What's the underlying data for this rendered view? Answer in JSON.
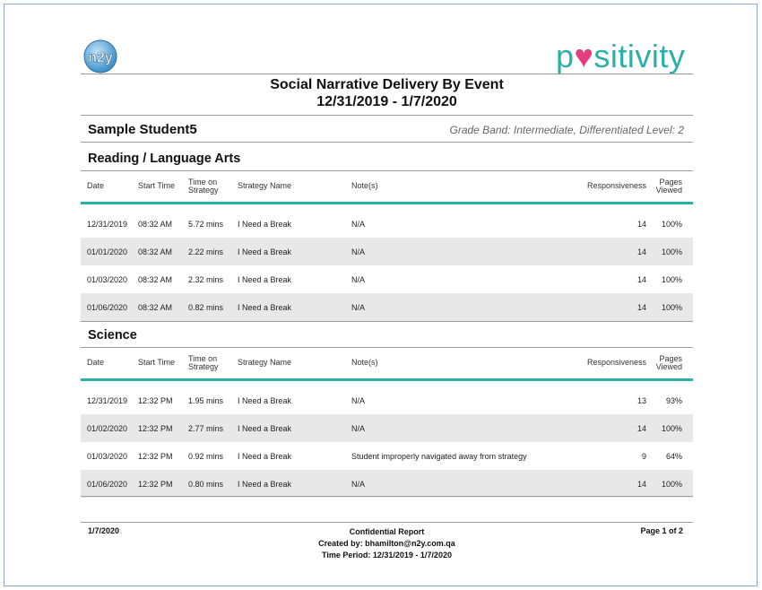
{
  "header": {
    "title": "Social Narrative Delivery By Event",
    "date_range": "12/31/2019 - 1/7/2020",
    "logo_left_text": "n2y",
    "logo_right": {
      "pre": "p",
      "heart": "♥",
      "post": "sitivity"
    }
  },
  "student": {
    "name": "Sample Student5",
    "grade_band": "Grade Band: Intermediate, Differentiated Level: 2"
  },
  "columns": {
    "date": "Date",
    "start_time": "Start Time",
    "time_on_1": "Time on",
    "time_on_2": "Strategy",
    "strategy": "Strategy Name",
    "notes": "Note(s)",
    "responsiveness": "Responsiveness",
    "pages_1": "Pages",
    "pages_2": "Viewed"
  },
  "sections": [
    {
      "title": "Reading / Language Arts",
      "rows": [
        {
          "date": "12/31/2019",
          "start": "08:32 AM",
          "time": "5.72 mins",
          "strategy": "I Need a Break",
          "notes": "N/A",
          "resp": "14",
          "pages": "100%"
        },
        {
          "date": "01/01/2020",
          "start": "08:32 AM",
          "time": "2.22 mins",
          "strategy": "I Need a Break",
          "notes": "N/A",
          "resp": "14",
          "pages": "100%"
        },
        {
          "date": "01/03/2020",
          "start": "08:32 AM",
          "time": "2.32 mins",
          "strategy": "I Need a Break",
          "notes": "N/A",
          "resp": "14",
          "pages": "100%"
        },
        {
          "date": "01/06/2020",
          "start": "08:32 AM",
          "time": "0.82 mins",
          "strategy": "I Need a Break",
          "notes": "N/A",
          "resp": "14",
          "pages": "100%"
        }
      ]
    },
    {
      "title": "Science",
      "rows": [
        {
          "date": "12/31/2019",
          "start": "12:32 PM",
          "time": "1.95 mins",
          "strategy": "I Need a Break",
          "notes": "N/A",
          "resp": "13",
          "pages": "93%"
        },
        {
          "date": "01/02/2020",
          "start": "12:32 PM",
          "time": "2.77 mins",
          "strategy": "I Need a Break",
          "notes": "N/A",
          "resp": "14",
          "pages": "100%"
        },
        {
          "date": "01/03/2020",
          "start": "12:32 PM",
          "time": "0.92 mins",
          "strategy": "I Need a Break",
          "notes": "Student improperly navigated away from strategy",
          "resp": "9",
          "pages": "64%"
        },
        {
          "date": "01/06/2020",
          "start": "12:32 PM",
          "time": "0.80 mins",
          "strategy": "I Need a Break",
          "notes": "N/A",
          "resp": "14",
          "pages": "100%"
        }
      ]
    }
  ],
  "footer": {
    "date": "1/7/2020",
    "confidential": "Confidential Report",
    "created_by": "Created by: bhamilton@n2y.com.qa",
    "time_period": "Time Period: 12/31/2019 - 1/7/2020",
    "page": "Page 1 of 2"
  }
}
